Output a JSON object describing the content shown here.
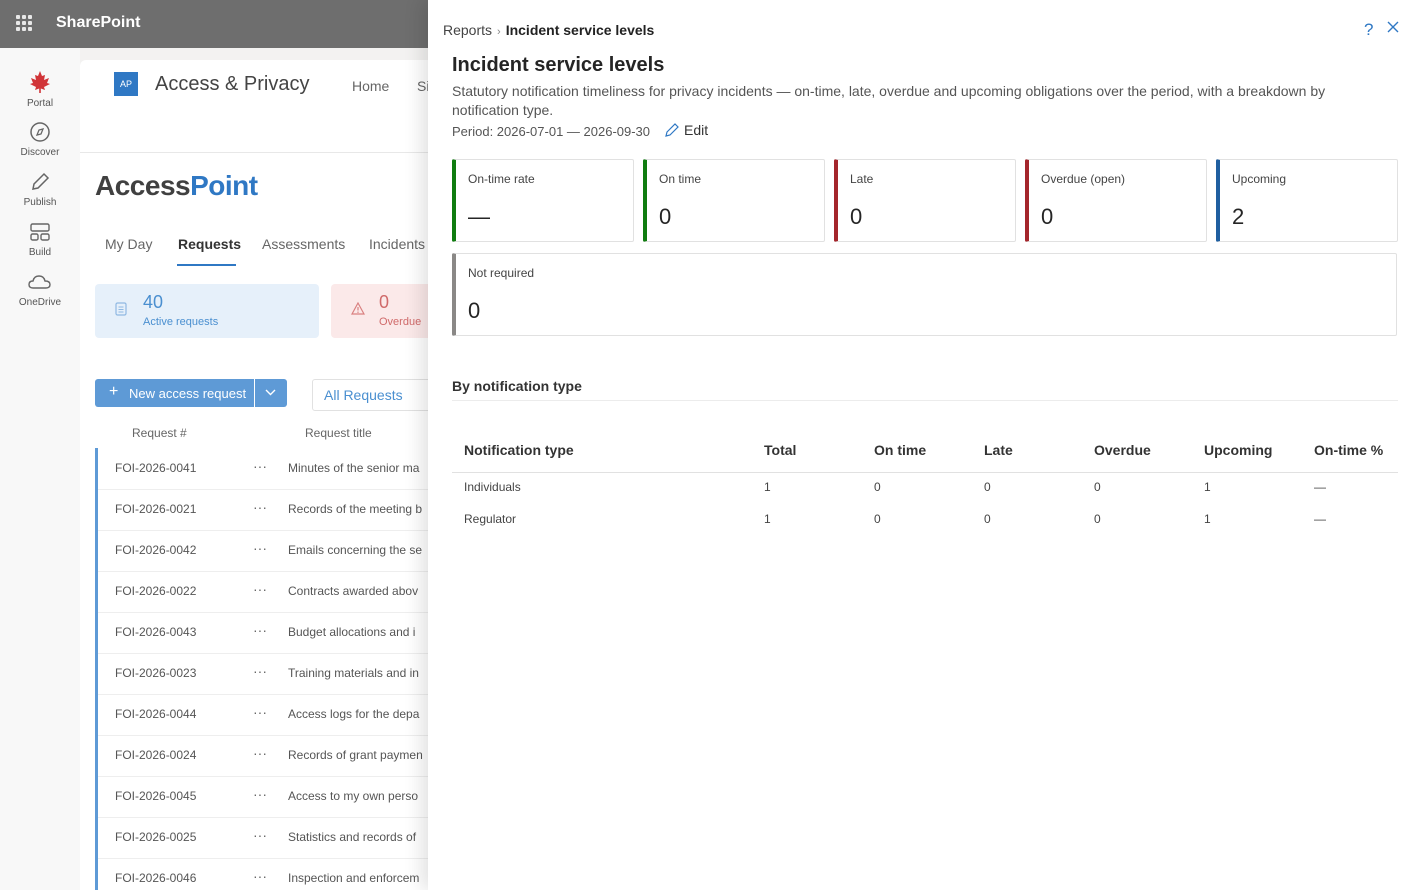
{
  "suite": {
    "app_name": "SharePoint"
  },
  "rail": [
    {
      "label": "Portal",
      "icon": "maple-leaf-icon"
    },
    {
      "label": "Discover",
      "icon": "compass-icon"
    },
    {
      "label": "Publish",
      "icon": "pen-icon"
    },
    {
      "label": "Build",
      "icon": "grid-icon"
    },
    {
      "label": "OneDrive",
      "icon": "cloud-icon"
    }
  ],
  "site": {
    "logo_text": "AP",
    "title": "Access & Privacy",
    "nav": [
      "Home",
      "Si"
    ],
    "brand_a": "Access",
    "brand_b": "Point",
    "tabs": [
      "My Day",
      "Requests",
      "Assessments",
      "Incidents"
    ],
    "active_tab": "Requests",
    "stats": [
      {
        "value": "40",
        "label": "Active requests"
      },
      {
        "value": "0",
        "label": "Overdue"
      }
    ],
    "new_button": "New access request",
    "view_selector": "All Requests",
    "columns": [
      "Request #",
      "Request title"
    ],
    "rows": [
      {
        "id": "FOI-2026-0041",
        "title": "Minutes of the senior ma"
      },
      {
        "id": "FOI-2026-0021",
        "title": "Records of the meeting b"
      },
      {
        "id": "FOI-2026-0042",
        "title": "Emails concerning the se"
      },
      {
        "id": "FOI-2026-0022",
        "title": "Contracts awarded abov"
      },
      {
        "id": "FOI-2026-0043",
        "title": "Budget allocations and i"
      },
      {
        "id": "FOI-2026-0023",
        "title": "Training materials and in"
      },
      {
        "id": "FOI-2026-0044",
        "title": "Access logs for the depa"
      },
      {
        "id": "FOI-2026-0024",
        "title": "Records of grant paymen"
      },
      {
        "id": "FOI-2026-0045",
        "title": "Access to my own perso"
      },
      {
        "id": "FOI-2026-0025",
        "title": "Statistics and records of"
      },
      {
        "id": "FOI-2026-0046",
        "title": "Inspection and enforcem"
      }
    ],
    "row_menu": "···"
  },
  "panel": {
    "breadcrumb_parent": "Reports",
    "breadcrumb_sep": "›",
    "breadcrumb_current": "Incident service levels",
    "help": "?",
    "title": "Incident service levels",
    "description": "Statutory notification timeliness for privacy incidents — on-time, late, overdue and upcoming obligations over the period, with a breakdown by notification type.",
    "period": "Period: 2026-07-01 — 2026-09-30",
    "edit_label": "Edit",
    "kpis": [
      {
        "label": "On-time rate",
        "value": "—",
        "color": "#107c10"
      },
      {
        "label": "On time",
        "value": "0",
        "color": "#107c10"
      },
      {
        "label": "Late",
        "value": "0",
        "color": "#a4262c"
      },
      {
        "label": "Overdue (open)",
        "value": "0",
        "color": "#a4262c"
      },
      {
        "label": "Upcoming",
        "value": "2",
        "color": "#1f5fa0"
      },
      {
        "label": "Not required",
        "value": "0",
        "color": "#8a8886"
      }
    ],
    "section_title": "By notification type",
    "table": {
      "headers": [
        "Notification type",
        "Total",
        "On time",
        "Late",
        "Overdue",
        "Upcoming",
        "On-time %"
      ],
      "rows": [
        [
          "Individuals",
          "1",
          "0",
          "0",
          "0",
          "1",
          "—"
        ],
        [
          "Regulator",
          "1",
          "0",
          "0",
          "0",
          "1",
          "—"
        ]
      ]
    }
  }
}
